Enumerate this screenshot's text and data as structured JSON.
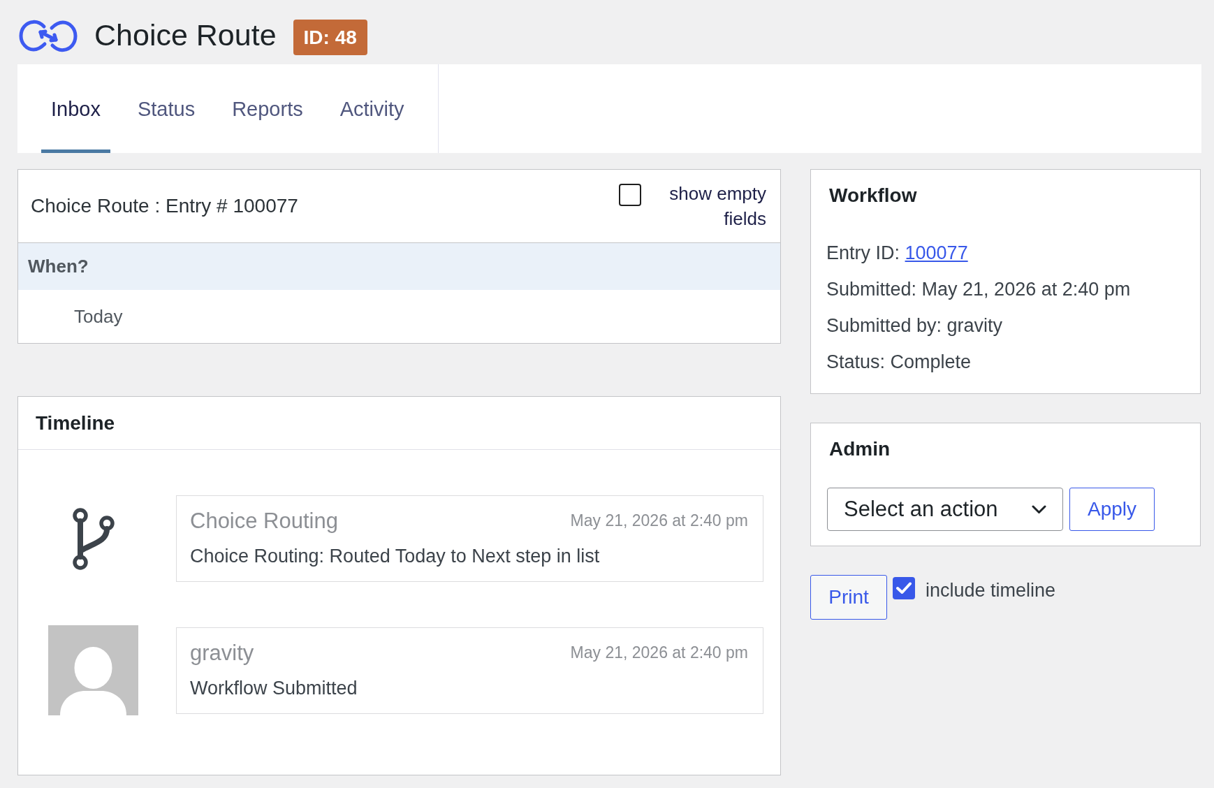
{
  "header": {
    "title": "Choice Route",
    "badge": "ID: 48"
  },
  "tabs": [
    {
      "label": "Inbox",
      "selected": true
    },
    {
      "label": "Status",
      "selected": false
    },
    {
      "label": "Reports",
      "selected": false
    },
    {
      "label": "Activity",
      "selected": false
    }
  ],
  "entry": {
    "title": "Choice Route : Entry # 100077",
    "show_empty_fields": {
      "label": "show empty fields",
      "checked": false
    },
    "fields": [
      {
        "label": "When?",
        "value": "Today"
      }
    ]
  },
  "timeline": {
    "title": "Timeline",
    "items": [
      {
        "kind": "step",
        "title": "Choice Routing",
        "date": "May 21, 2026 at 2:40 pm",
        "text": "Choice Routing: Routed Today to Next step in list"
      },
      {
        "kind": "user",
        "title": "gravity",
        "date": "May 21, 2026 at 2:40 pm",
        "text": "Workflow Submitted"
      }
    ]
  },
  "workflow": {
    "title": "Workflow",
    "lines": [
      {
        "kind": "link",
        "label": "Entry ID:",
        "link": "100077"
      },
      {
        "kind": "text",
        "text": "Submitted: May 21, 2026 at 2:40 pm"
      },
      {
        "kind": "text",
        "text": "Submitted by: gravity"
      },
      {
        "kind": "text",
        "text": "Status: Complete"
      }
    ]
  },
  "admin": {
    "title": "Admin",
    "select": {
      "value": "Select an action"
    },
    "apply": "Apply"
  },
  "print": {
    "button": "Print",
    "include_timeline": {
      "label": "include timeline",
      "checked": true
    }
  }
}
